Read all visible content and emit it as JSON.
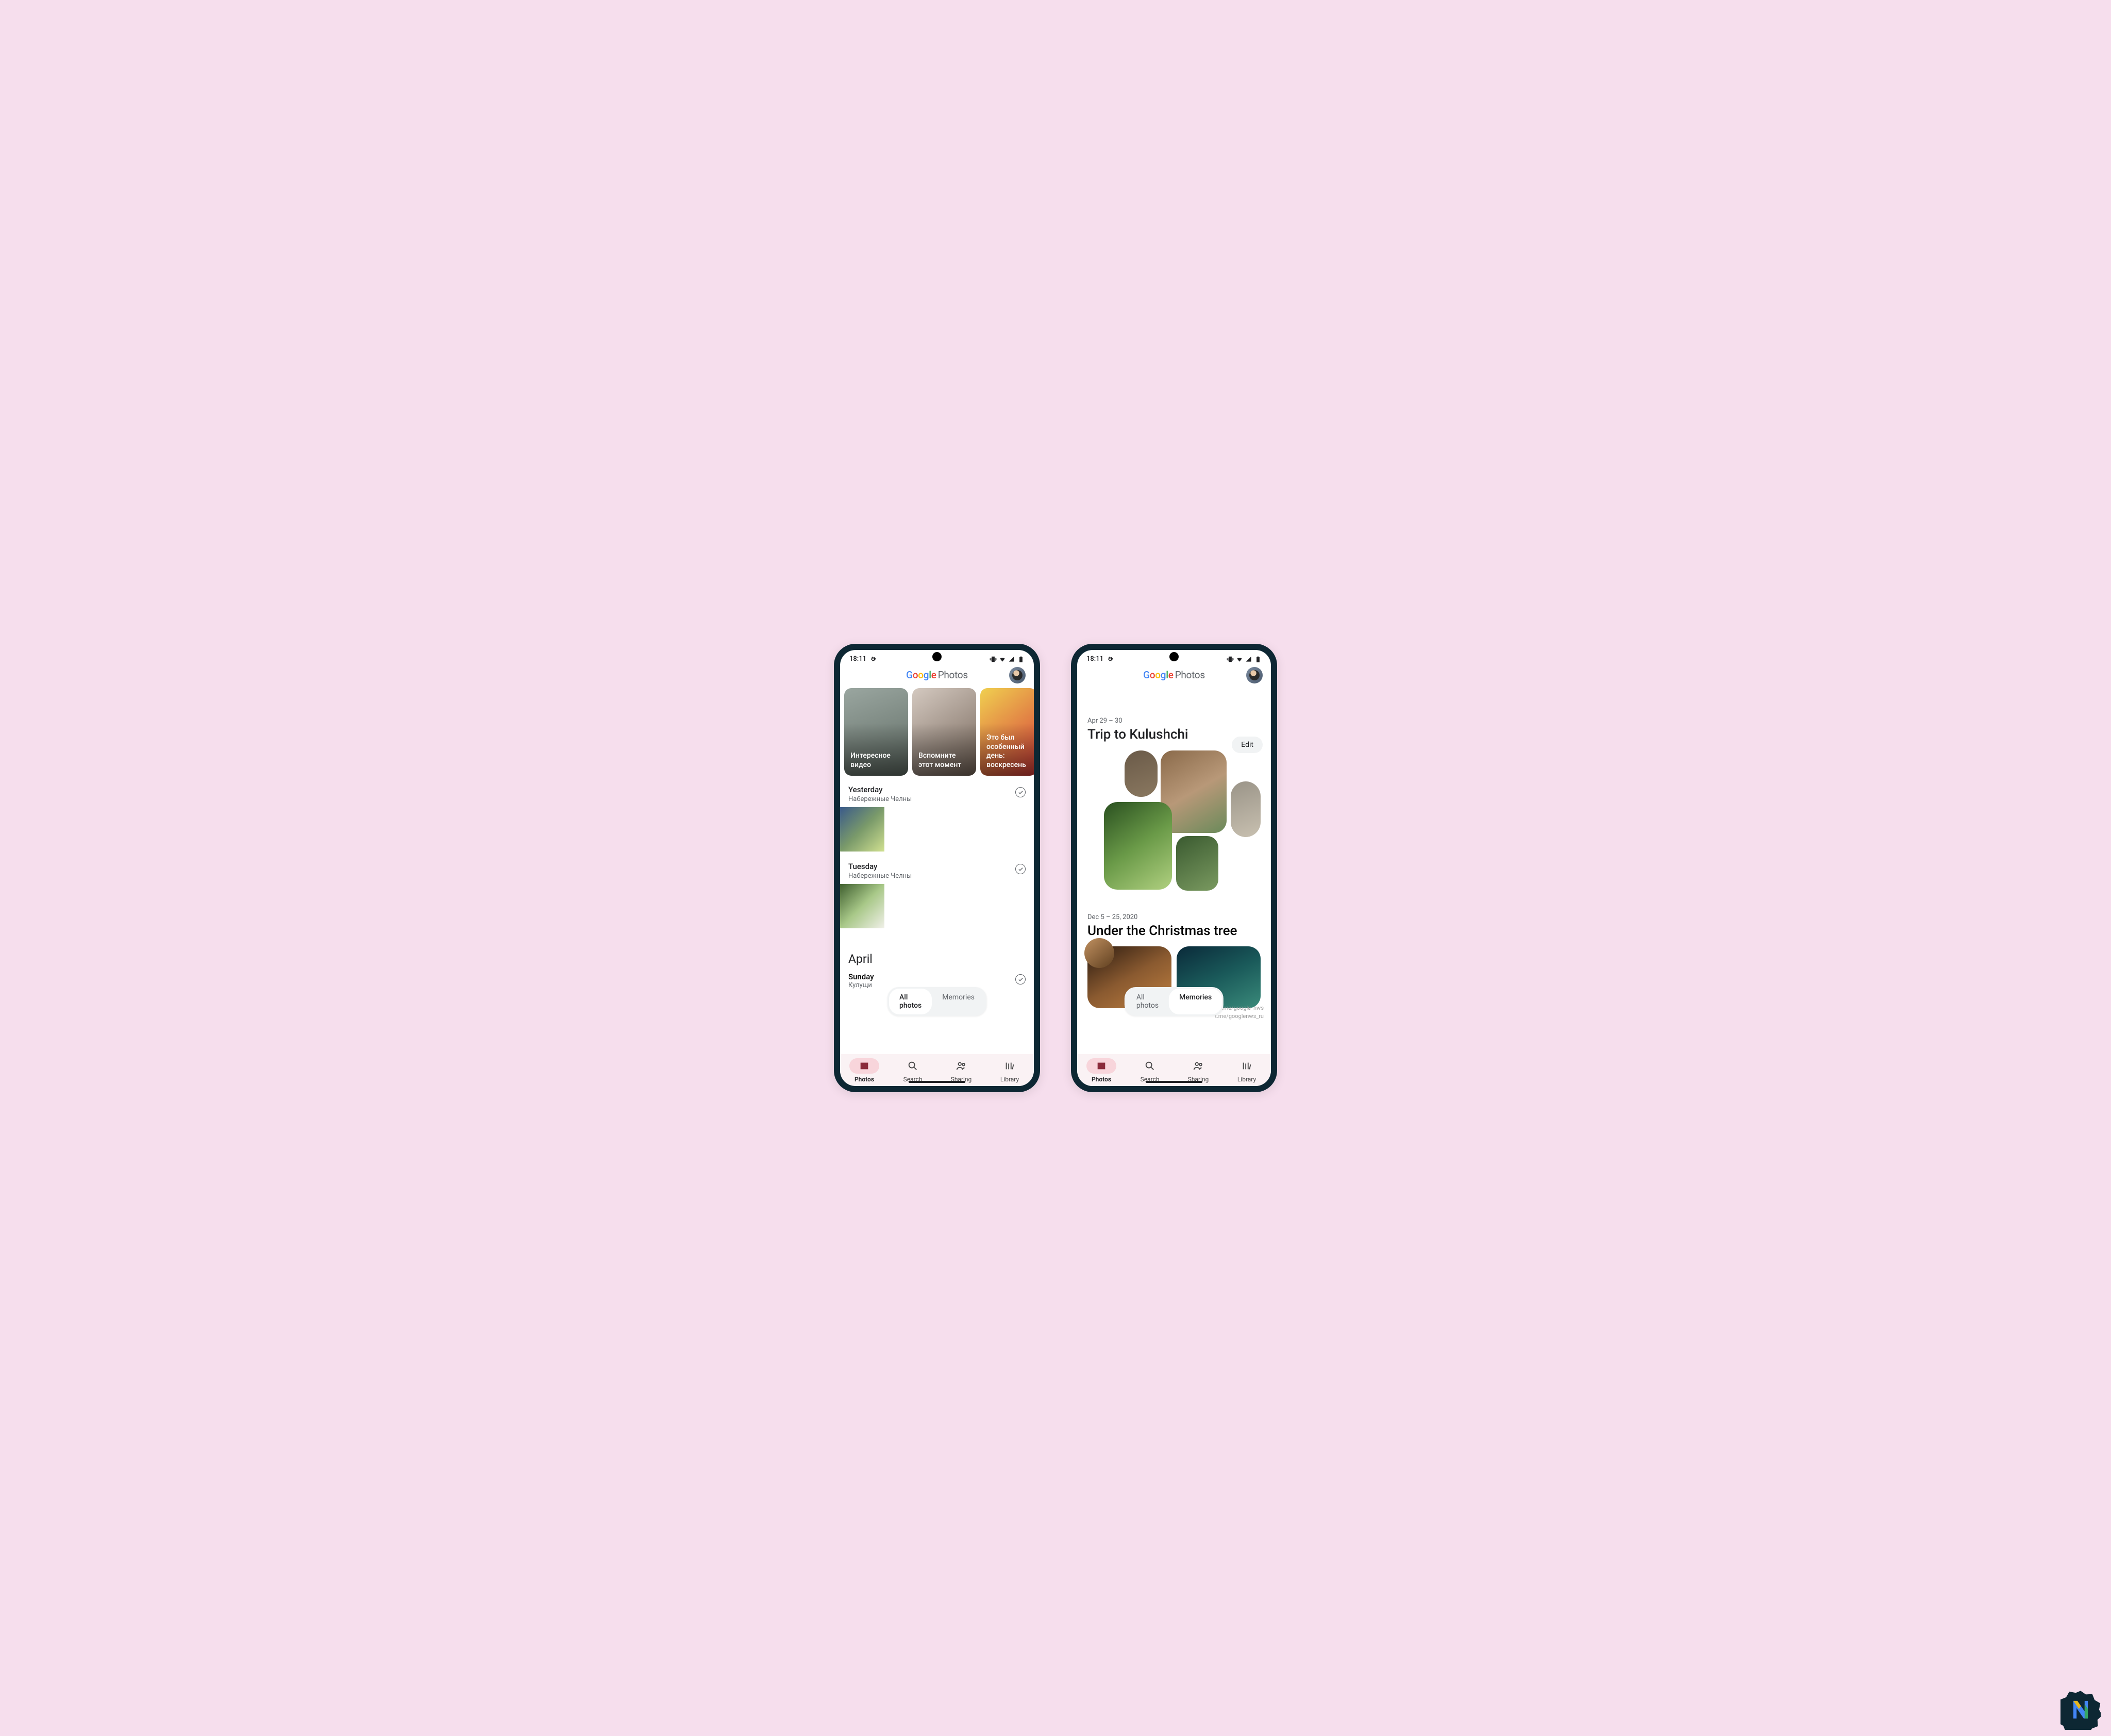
{
  "status": {
    "time": "18:11"
  },
  "appbar": {
    "brand_text": "Photos"
  },
  "filter": {
    "all": "All photos",
    "memories": "Memories"
  },
  "nav": {
    "photos": "Photos",
    "search": "Search",
    "sharing": "Sharing",
    "library": "Library"
  },
  "left": {
    "mem1": "Интересное видео",
    "mem2": "Вспомните этот момент",
    "mem3": "Это был особенный день: воскресень",
    "yesterday": {
      "title": "Yesterday",
      "sub": "Набережные Челны"
    },
    "tuesday": {
      "title": "Tuesday",
      "sub": "Набережные Челны"
    },
    "month": "April",
    "sunday": {
      "title": "Sunday",
      "sub": "Кулущи"
    }
  },
  "right": {
    "edit": "Edit",
    "trip": {
      "date": "Apr 29 – 30",
      "title": "Trip to Kulushchi"
    },
    "xmas": {
      "date": "Dec 5 – 25, 2020",
      "title": "Under the Christmas tree"
    },
    "watermark1": "t.me/google_nws",
    "watermark2": "t.me/googlenws_ru"
  }
}
